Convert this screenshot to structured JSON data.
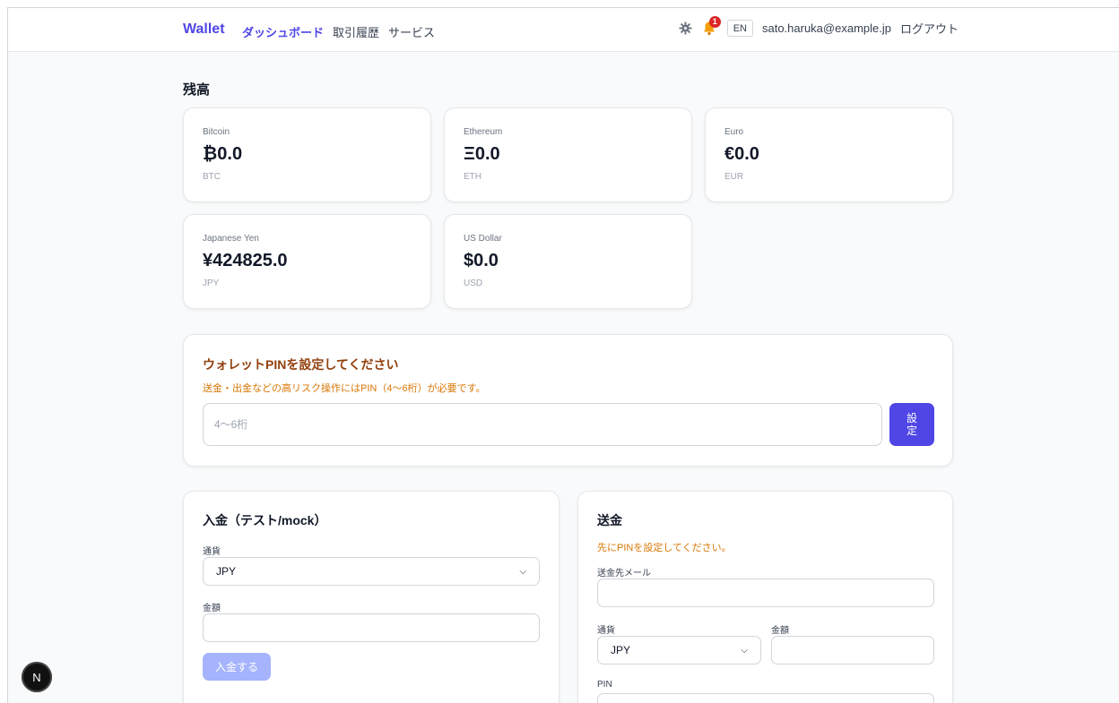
{
  "header": {
    "brand": "Wallet",
    "nav": [
      "ダッシュボード",
      "取引履歴",
      "サービス"
    ],
    "notification_count": "1",
    "lang": "EN",
    "email": "sato.haruka@example.jp",
    "logout": "ログアウト"
  },
  "balances": {
    "title": "残高",
    "items": [
      {
        "name": "Bitcoin",
        "amount": "₿0.0",
        "code": "BTC"
      },
      {
        "name": "Ethereum",
        "amount": "Ξ0.0",
        "code": "ETH"
      },
      {
        "name": "Euro",
        "amount": "€0.0",
        "code": "EUR"
      },
      {
        "name": "Japanese Yen",
        "amount": "¥424825.0",
        "code": "JPY"
      },
      {
        "name": "US Dollar",
        "amount": "$0.0",
        "code": "USD"
      }
    ]
  },
  "pin": {
    "title": "ウォレットPINを設定してください",
    "description": "送金・出金などの高リスク操作にはPIN（4〜6桁）が必要です。",
    "placeholder": "4〜6桁",
    "button": "設\n定"
  },
  "deposit": {
    "title": "入金（テスト/mock）",
    "currency_label": "通貨",
    "currency_value": "JPY",
    "amount_label": "金額",
    "amount_value": "",
    "button": "入金する"
  },
  "transfer": {
    "title": "送金",
    "warning": "先にPINを設定してください。",
    "recipient_label": "送金先メール",
    "currency_label": "通貨",
    "currency_value": "JPY",
    "amount_label": "金額",
    "pin_label": "PIN"
  },
  "dev_indicator": "N",
  "colors": {
    "accent": "#4f46e5",
    "warning": "#d97706",
    "badge": "#dc2626"
  }
}
